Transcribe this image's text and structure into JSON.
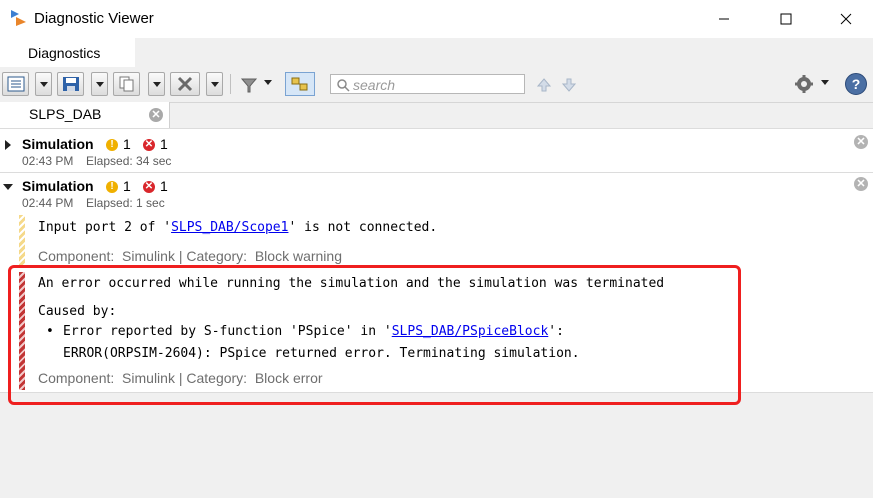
{
  "window": {
    "title": "Diagnostic Viewer"
  },
  "tabs": {
    "main": "Diagnostics",
    "model": "SLPS_DAB"
  },
  "search": {
    "placeholder": "search"
  },
  "sessions": [
    {
      "title": "Simulation",
      "warnings": "1",
      "errors": "1",
      "time": "02:43 PM",
      "elapsed": "Elapsed: 34 sec",
      "expanded": false
    },
    {
      "title": "Simulation",
      "warnings": "1",
      "errors": "1",
      "time": "02:44 PM",
      "elapsed": "Elapsed: 1 sec",
      "expanded": true
    }
  ],
  "warning_msg": {
    "prefix": "Input port 2 of '",
    "link": "SLPS_DAB/Scope1",
    "suffix": "' is not connected.",
    "component": "Component:  Simulink | Category:  Block warning"
  },
  "error_msg": {
    "line1": "An error occurred while running the simulation and the simulation was terminated",
    "caused_by": "Caused by:",
    "bullet_prefix": "Error reported by S-function 'PSpice' in '",
    "bullet_link": "SLPS_DAB/PSpiceBlock",
    "bullet_suffix": "':",
    "detail": "ERROR(ORPSIM-2604): PSpice returned error. Terminating simulation.",
    "component": "Component:  Simulink | Category:  Block error"
  },
  "colors": {
    "highlight_box": "#ef1f1f",
    "link": "#0000ee",
    "warning": "#f0b000",
    "error": "#d9262b"
  }
}
